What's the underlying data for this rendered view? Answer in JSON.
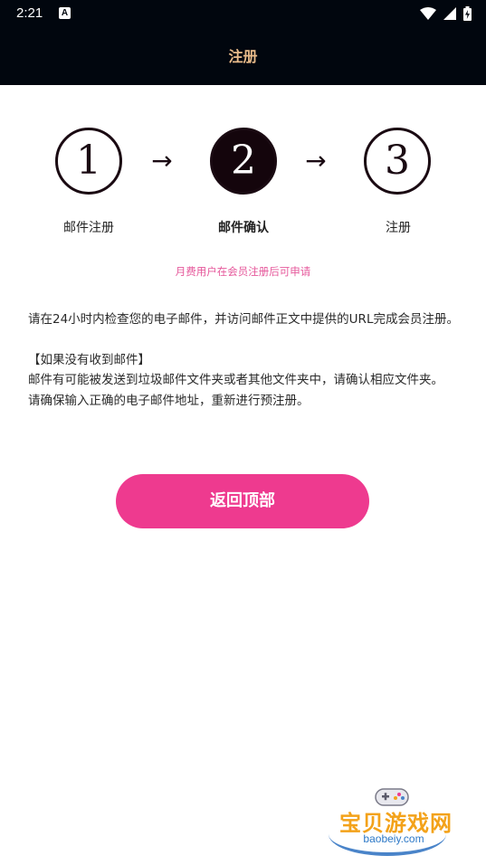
{
  "status_bar": {
    "time": "2:21",
    "notification_icon": "A"
  },
  "header": {
    "title": "注册"
  },
  "steps": [
    {
      "number": "1",
      "label": "邮件注册",
      "active": false
    },
    {
      "number": "2",
      "label": "邮件确认",
      "active": true
    },
    {
      "number": "3",
      "label": "注册",
      "active": false
    }
  ],
  "arrow_glyph": "→",
  "notice": "月费用户在会员注册后可申请",
  "body": {
    "paragraph1": "请在24小时内检查您的电子邮件，并访问邮件正文中提供的URL完成会员注册。",
    "heading": "【如果没有收到邮件】",
    "paragraph2": "邮件有可能被发送到垃圾邮件文件夹或者其他文件夹中，请确认相应文件夹。",
    "paragraph3": "请确保输入正确的电子邮件地址，重新进行预注册。"
  },
  "button": {
    "label": "返回顶部"
  },
  "watermark": {
    "text": "宝贝游戏网",
    "url": "baobeiy.com"
  },
  "colors": {
    "header_bg": "#01060e",
    "header_title": "#e9bb8a",
    "accent_pink": "#ee3a8f",
    "notice_pink": "#e6589b",
    "step_dark": "#14050c"
  }
}
